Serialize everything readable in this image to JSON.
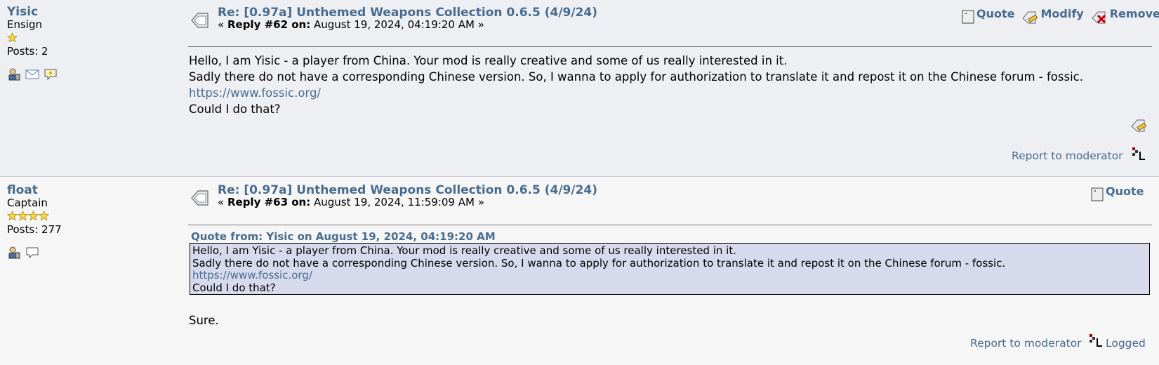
{
  "posts": [
    {
      "poster": {
        "name": "Yisic",
        "rank": "Ensign",
        "stars": 1,
        "posts": "Posts: 2"
      },
      "subject": "Re: [0.97a] Unthemed Weapons Collection 0.6.5 (4/9/24)",
      "reply_prefix": "«",
      "reply_label": "Reply #62 on:",
      "reply_date": "August 19, 2024, 04:19:20 AM",
      "reply_suffix": "»",
      "actions": {
        "quote": "Quote",
        "modify": "Modify",
        "remove": "Remove"
      },
      "body": [
        "Hello, I am Yisic - a player from China. Your mod is really creative and some of us really interested in it.",
        "Sadly there do not have a corresponding Chinese version. So, I wanna to apply for authorization to translate it and repost it on the Chinese forum - fossic."
      ],
      "link": "https://www.fossic.org/",
      "body_end": "Could I do that?",
      "report": "Report to moderator"
    },
    {
      "poster": {
        "name": "float",
        "rank": "Captain",
        "stars": 4,
        "posts": "Posts: 277"
      },
      "subject": "Re: [0.97a] Unthemed Weapons Collection 0.6.5 (4/9/24)",
      "reply_prefix": "«",
      "reply_label": "Reply #63 on:",
      "reply_date": "August 19, 2024, 11:59:09 AM",
      "reply_suffix": "»",
      "actions": {
        "quote": "Quote"
      },
      "quote": {
        "header": "Quote from: Yisic on August 19, 2024, 04:19:20 AM",
        "lines": [
          "Hello, I am Yisic - a player from China. Your mod is really creative and some of us really interested in it.",
          "Sadly there do not have a corresponding Chinese version. So, I wanna to apply for authorization to translate it and repost it on the Chinese forum - fossic."
        ],
        "link": "https://www.fossic.org/",
        "end": "Could I do that?"
      },
      "body": "Sure.",
      "report": "Report to moderator",
      "logged": "Logged"
    }
  ],
  "colors": {
    "link": "#476c8e",
    "quote_bg": "#d7daec",
    "post1_bg": "#eeeff3",
    "post2_bg": "#f6f6f6",
    "star": "#f2c200"
  }
}
